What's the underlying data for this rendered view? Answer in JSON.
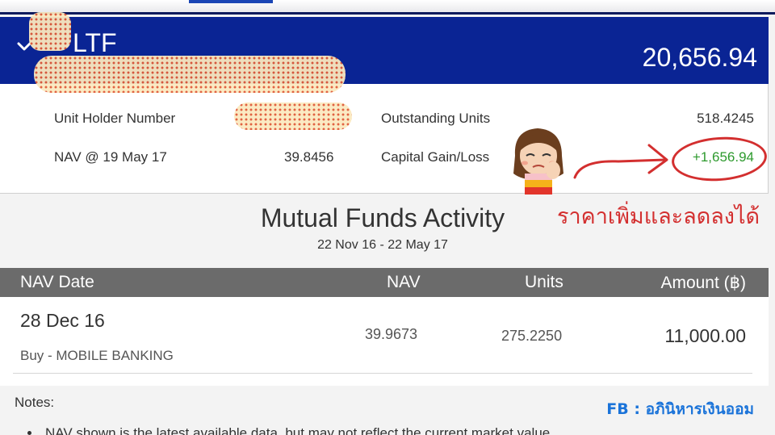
{
  "fund": {
    "name": "LTF",
    "total_value": "20,656.94"
  },
  "details": {
    "unit_holder_label": "Unit Holder Number",
    "outstanding_units_label": "Outstanding Units",
    "outstanding_units_value": "518.4245",
    "nav_label": "NAV @ 19 May 17",
    "nav_value": "39.8456",
    "capital_gain_label": "Capital Gain/Loss",
    "capital_gain_value": "+1,656.94"
  },
  "annotation": {
    "thai_note": "ราคาเพิ่มและลดลงได้",
    "fb_credit": "FB : อภินิหารเงินออม"
  },
  "activity": {
    "title": "Mutual Funds Activity",
    "date_range": "22 Nov 16 - 22 May 17",
    "columns": [
      "NAV Date",
      "NAV",
      "Units",
      "Amount (฿)"
    ],
    "rows": [
      {
        "date": "28 Dec 16",
        "type": "Buy - MOBILE BANKING",
        "nav": "39.9673",
        "units": "275.2250",
        "amount": "11,000.00"
      }
    ]
  },
  "notes": {
    "label": "Notes:",
    "line1": "NAV shown is the latest available data, but may not reflect the current market value."
  },
  "colors": {
    "header_blue": "#0a2494",
    "gain_green": "#2e9a2e",
    "annotation_red": "#d32f2f",
    "table_header_gray": "#6b6b6b",
    "credit_blue": "#1a73d9"
  },
  "icons": [
    "chevron-down-icon",
    "arrow-annotation-icon",
    "avatar-sticker"
  ]
}
